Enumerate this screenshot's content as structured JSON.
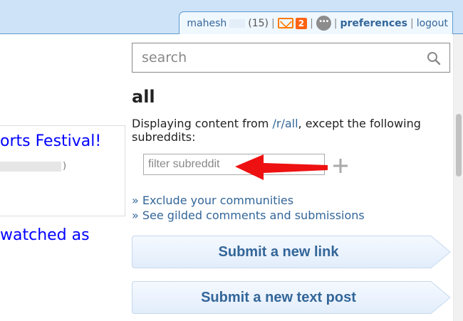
{
  "user_bar": {
    "username": "mahesh",
    "karma": "(15)",
    "mail_count": "2",
    "separator": "|",
    "preferences": "preferences",
    "logout": "logout",
    "icons": {
      "mail": "mail-icon",
      "chat": "chat-icon"
    },
    "colors": {
      "mail": "#ff6314",
      "link": "#336699",
      "band": "#cee3f8"
    }
  },
  "left_column": {
    "post_title": "orts Festival!",
    "post_sub_close": ")",
    "post_title_2": "watched as"
  },
  "search": {
    "placeholder": "search"
  },
  "sidebar": {
    "title": "all",
    "desc_prefix": "Displaying content from ",
    "desc_link": "/r/all",
    "desc_suffix": ", except the following subreddits:",
    "filter_placeholder": "filter subreddit",
    "links": [
      "» Exclude your communities",
      "» See gilded comments and submissions"
    ],
    "submit_link": "Submit a new link",
    "submit_text": "Submit a new text post"
  },
  "annotation": {
    "arrow_color": "#ee1111"
  }
}
